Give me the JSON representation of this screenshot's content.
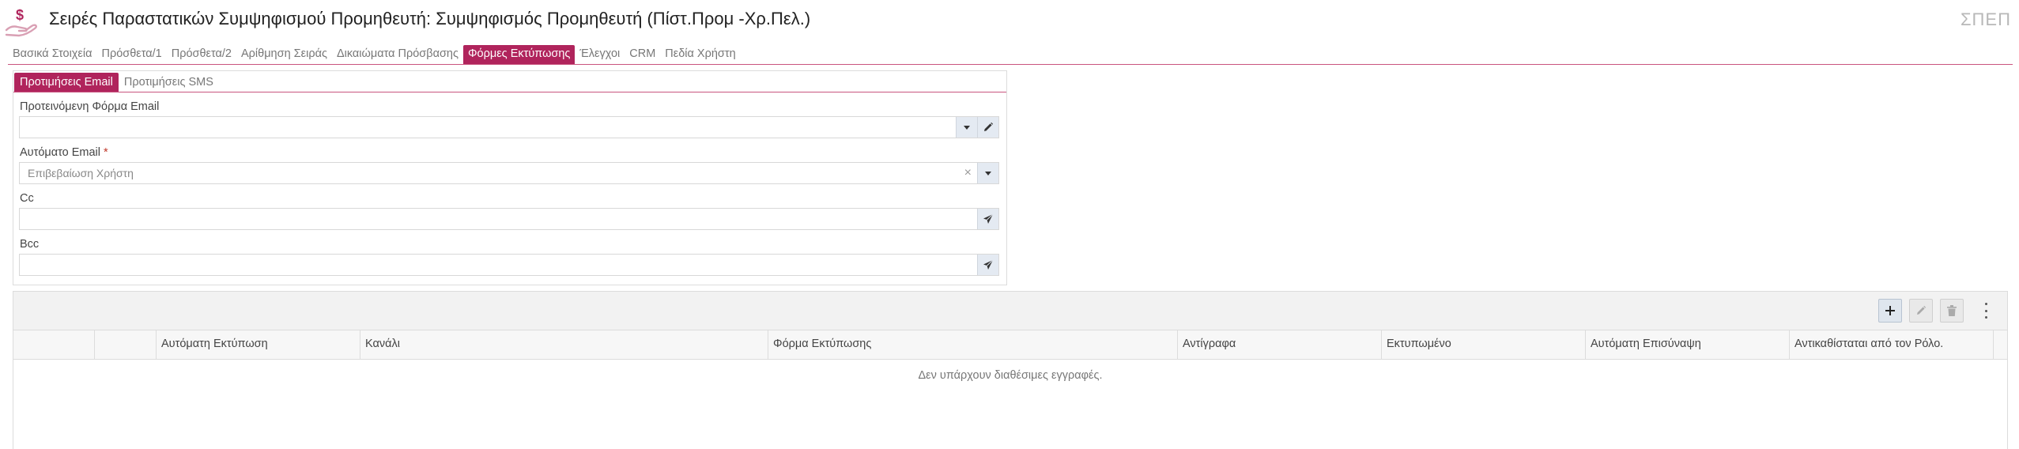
{
  "header": {
    "title": "Σειρές Παραστατικών Συμψηφισμού Προμηθευτή: Συμψηφισμός Προμηθευτή (Πίστ.Προμ -Χρ.Πελ.)",
    "code": "ΣΠΕΠ",
    "logo_icon": "money-hand-icon"
  },
  "colors": {
    "accent": "#b0245c",
    "line": "#c9557f"
  },
  "tabs": [
    {
      "label": "Βασικά Στοιχεία"
    },
    {
      "label": "Πρόσθετα/1"
    },
    {
      "label": "Πρόσθετα/2"
    },
    {
      "label": "Αρίθμηση Σειράς"
    },
    {
      "label": "Δικαιώματα Πρόσβασης"
    },
    {
      "label": "Φόρμες Εκτύπωσης",
      "active": true
    },
    {
      "label": "Έλεγχοι"
    },
    {
      "label": "CRM"
    },
    {
      "label": "Πεδία Χρήστη"
    }
  ],
  "subtabs": [
    {
      "label": "Προτιμήσεις Email",
      "active": true
    },
    {
      "label": "Προτιμήσεις SMS"
    }
  ],
  "form": {
    "default_email_form": {
      "label": "Προτεινόμενη Φόρμα Email",
      "value": ""
    },
    "auto_email": {
      "label": "Αυτόματο Email",
      "required_mark": "*",
      "value": "Επιβεβαίωση Χρήστη"
    },
    "cc": {
      "label": "Cc",
      "value": ""
    },
    "bcc": {
      "label": "Bcc",
      "value": ""
    }
  },
  "grid": {
    "columns": [
      "",
      "",
      "Αυτόματη Εκτύπωση",
      "Κανάλι",
      "Φόρμα Εκτύπωσης",
      "Αντίγραφα",
      "Εκτυπωμένο",
      "Αυτόματη Επισύναψη",
      "Αντικαθίσταται από τον Ρόλο."
    ],
    "empty_message": "Δεν υπάρχουν διαθέσιμες εγγραφές."
  }
}
